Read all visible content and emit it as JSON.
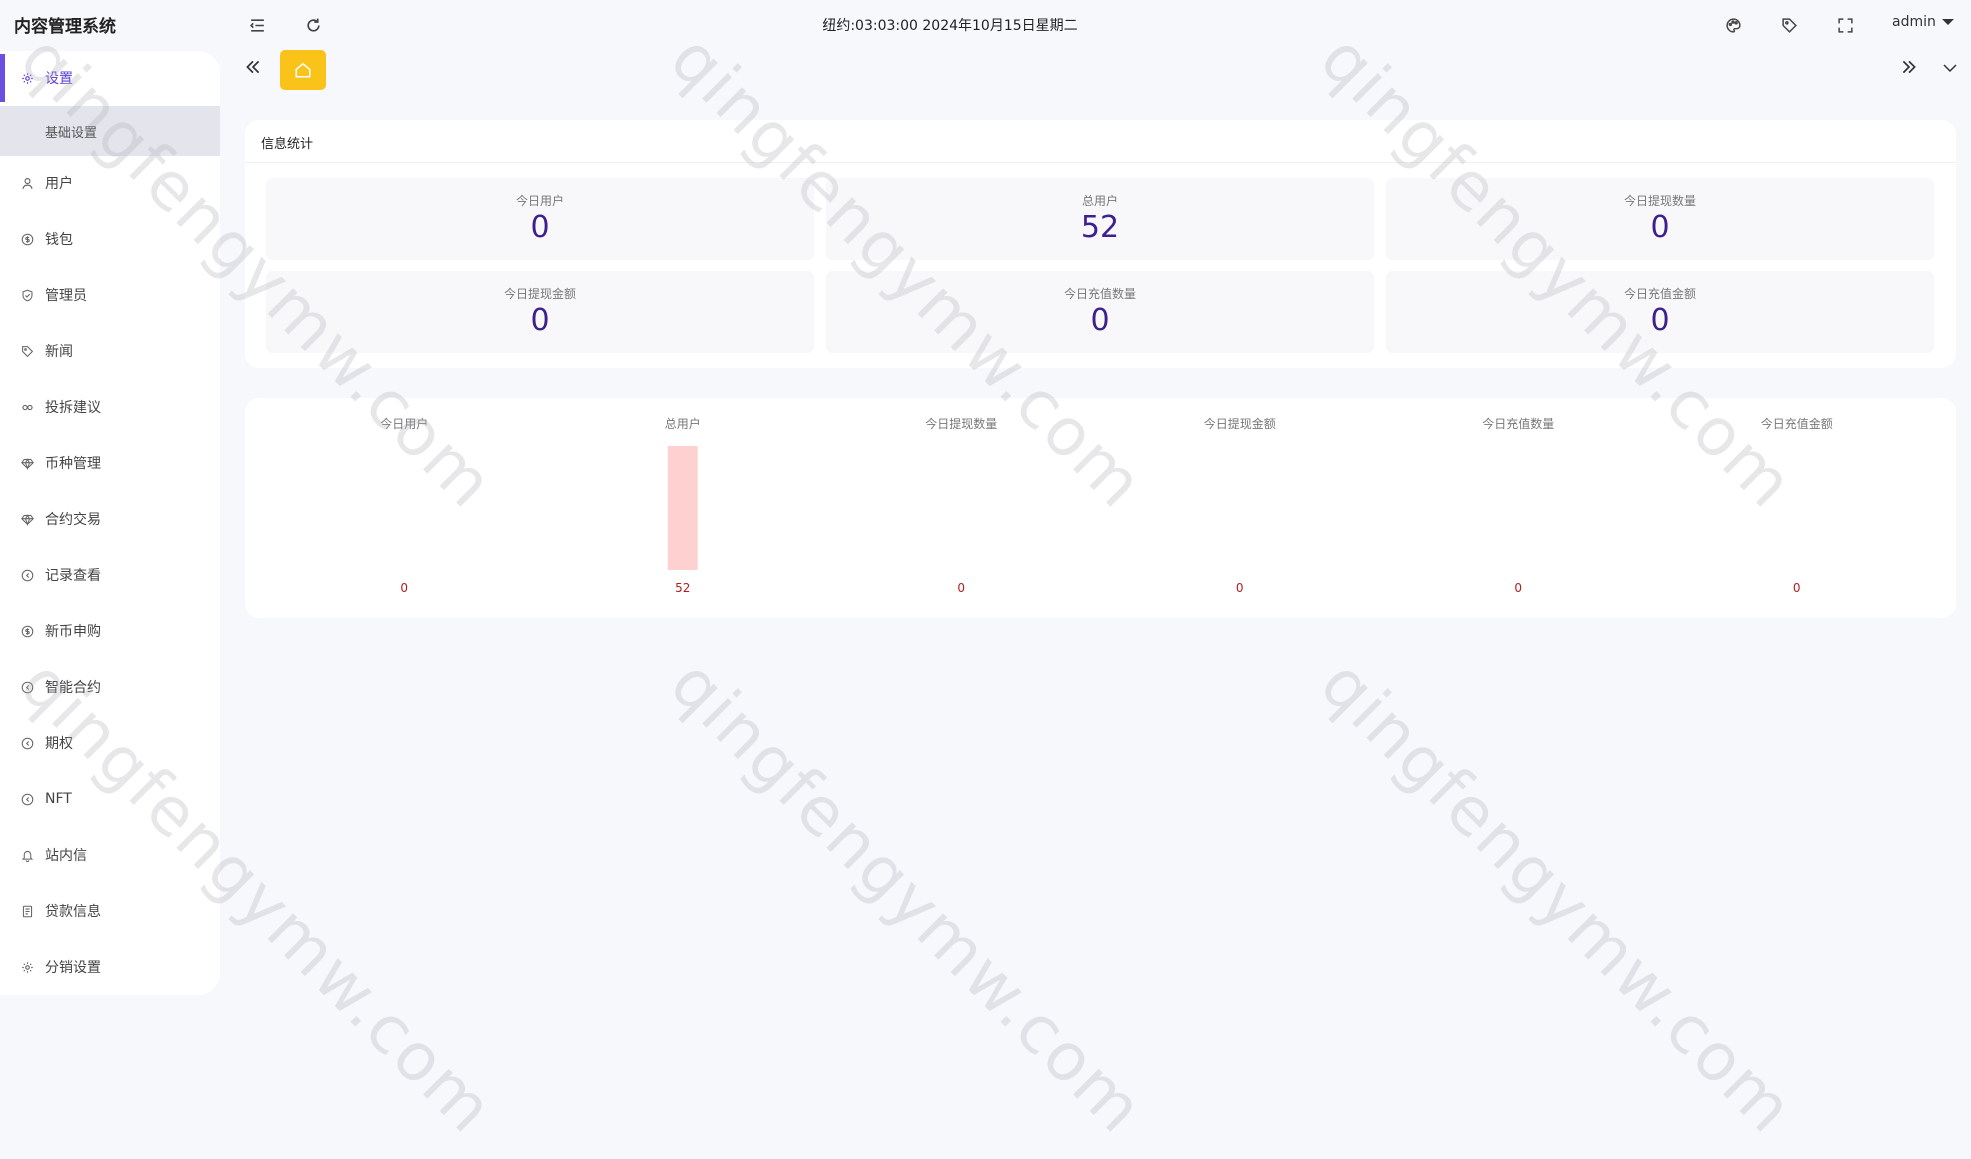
{
  "app": {
    "title": "内容管理系统"
  },
  "topbar": {
    "datetime": "纽约:03:03:00 2024年10月15日星期二",
    "user": "admin"
  },
  "sidebar": {
    "items": [
      {
        "label": "设置",
        "icon": "gear-icon"
      },
      {
        "label": "用户",
        "icon": "user-icon"
      },
      {
        "label": "钱包",
        "icon": "dollar-icon"
      },
      {
        "label": "管理员",
        "icon": "shield-check-icon"
      },
      {
        "label": "新闻",
        "icon": "tag-icon"
      },
      {
        "label": "投拆建议",
        "icon": "link-icon"
      },
      {
        "label": "币种管理",
        "icon": "diamond-icon"
      },
      {
        "label": "合约交易",
        "icon": "diamond-icon"
      },
      {
        "label": "记录查看",
        "icon": "circle-arrow-icon"
      },
      {
        "label": "新币申购",
        "icon": "dollar-icon"
      },
      {
        "label": "智能合约",
        "icon": "circle-arrow-icon"
      },
      {
        "label": "期权",
        "icon": "circle-arrow-icon"
      },
      {
        "label": "NFT",
        "icon": "circle-arrow-icon"
      },
      {
        "label": "站内信",
        "icon": "bell-icon"
      },
      {
        "label": "贷款信息",
        "icon": "document-icon"
      },
      {
        "label": "分销设置",
        "icon": "gear-icon"
      }
    ],
    "submenu": {
      "label": "基础设置"
    }
  },
  "stats": {
    "title": "信息统计",
    "cards": [
      {
        "label": "今日用户",
        "value": "0"
      },
      {
        "label": "总用户",
        "value": "52"
      },
      {
        "label": "今日提现数量",
        "value": "0"
      },
      {
        "label": "今日提现金额",
        "value": "0"
      },
      {
        "label": "今日充值数量",
        "value": "0"
      },
      {
        "label": "今日充值金额",
        "value": "0"
      }
    ]
  },
  "chart_data": {
    "type": "bar",
    "categories": [
      "今日用户",
      "总用户",
      "今日提现数量",
      "今日提现金额",
      "今日充值数量",
      "今日充值金额"
    ],
    "values": [
      0,
      52,
      0,
      0,
      0,
      0
    ],
    "title": "",
    "xlabel": "",
    "ylabel": "",
    "ylim": [
      0,
      52
    ],
    "grid": false,
    "bar_color": "#ffd0d0",
    "label_color": "#b02020"
  },
  "watermark": {
    "text": "qingfengymw.com"
  },
  "colors": {
    "accent": "#6a4fe0",
    "home_tab": "#f9c319",
    "stat_value": "#3d1f8f"
  }
}
